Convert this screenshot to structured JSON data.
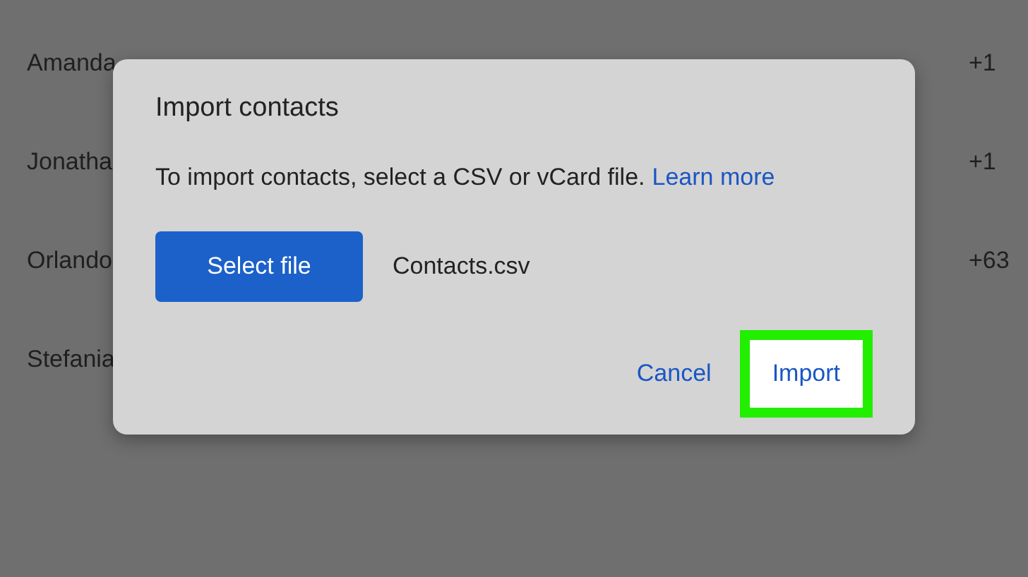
{
  "contacts": [
    {
      "name": "Amanda",
      "phone": "+1"
    },
    {
      "name": "Jonatha",
      "phone": "+1"
    },
    {
      "name": "Orlando",
      "phone": "+63"
    },
    {
      "name": "Stefania"
    }
  ],
  "dialog": {
    "title": "Import contacts",
    "message": "To import contacts, select a CSV or vCard file.",
    "link": "Learn more",
    "select_button": "Select file",
    "file_name": "Contacts.csv",
    "cancel_button": "Cancel",
    "import_button": "Import",
    "import_highlighted": true
  }
}
